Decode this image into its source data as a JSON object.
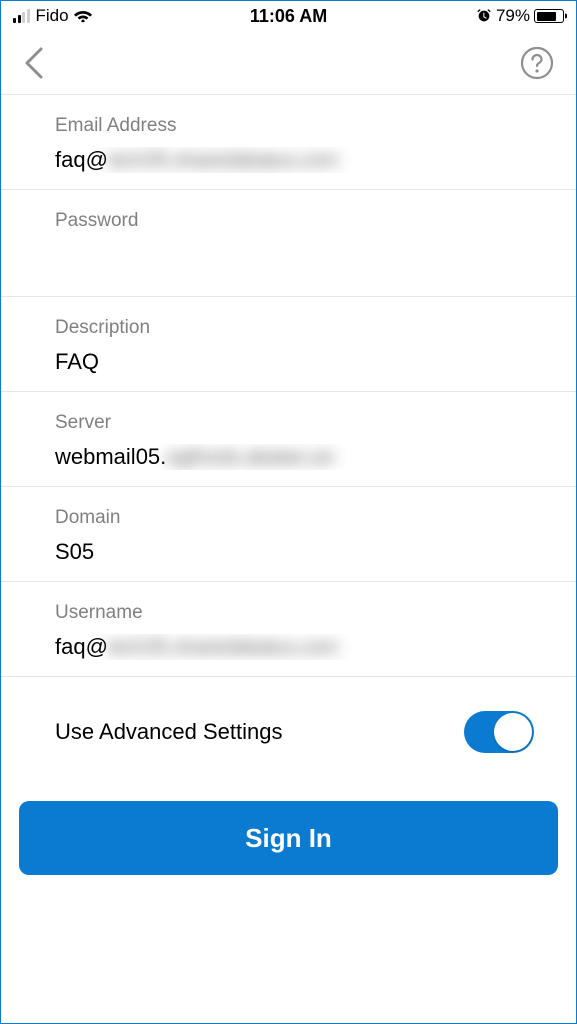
{
  "statusBar": {
    "carrier": "Fido",
    "time": "11:06 AM",
    "batteryPercent": "79%"
  },
  "form": {
    "emailLabel": "Email Address",
    "emailValue": "faq@",
    "passwordLabel": "Password",
    "passwordValue": "",
    "descriptionLabel": "Description",
    "descriptionValue": "FAQ",
    "serverLabel": "Server",
    "serverValue": "webmail05.",
    "domainLabel": "Domain",
    "domainValue": "S05",
    "usernameLabel": "Username",
    "usernameValue": "faq@"
  },
  "advanced": {
    "label": "Use Advanced Settings",
    "on": true
  },
  "signIn": {
    "label": "Sign In"
  }
}
